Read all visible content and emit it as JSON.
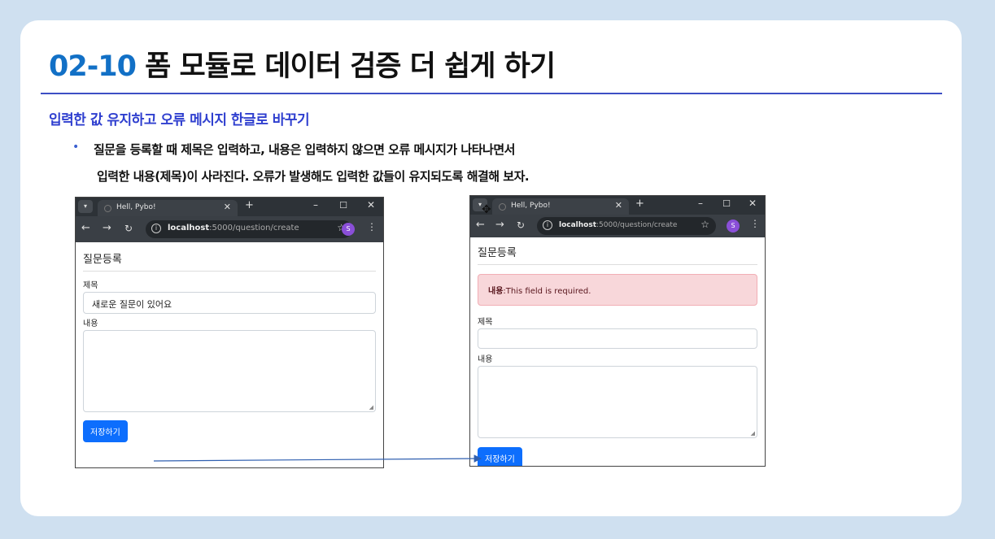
{
  "slide": {
    "title_num": "02-10",
    "title_text": " 폼 모듈로 데이터 검증 더 쉽게 하기",
    "subtitle": "입력한 값 유지하고 오류 메시지 한글로 바꾸기",
    "bullet_line1": "질문을 등록할 때 제목은 입력하고, 내용은 입력하지 않으면 오류 메시지가 나타나면서",
    "bullet_line2": "입력한 내용(제목)이 사라진다.  오류가 발생해도 입력한 값들이 유지되도록 해결해 보자."
  },
  "browser": {
    "tab_title": "Hell, Pybo!",
    "url_host": "localhost",
    "url_path": ":5000/question/create",
    "avatar_letter": "S"
  },
  "left_page": {
    "heading": "질문등록",
    "subject_label": "제목",
    "subject_value": "새로운 질문이 있어요",
    "content_label": "내용",
    "save_button": "저장하기"
  },
  "right_page": {
    "heading": "질문등록",
    "alert_field": "내용",
    "alert_message": ":This field is required.",
    "subject_label": "제목",
    "subject_value": "",
    "content_label": "내용",
    "save_button": "저장하기"
  },
  "colors": {
    "accent": "#1270c6",
    "subtitle": "#2f3fcf",
    "button": "#0d6efd",
    "alert_bg": "#f8d7da"
  }
}
